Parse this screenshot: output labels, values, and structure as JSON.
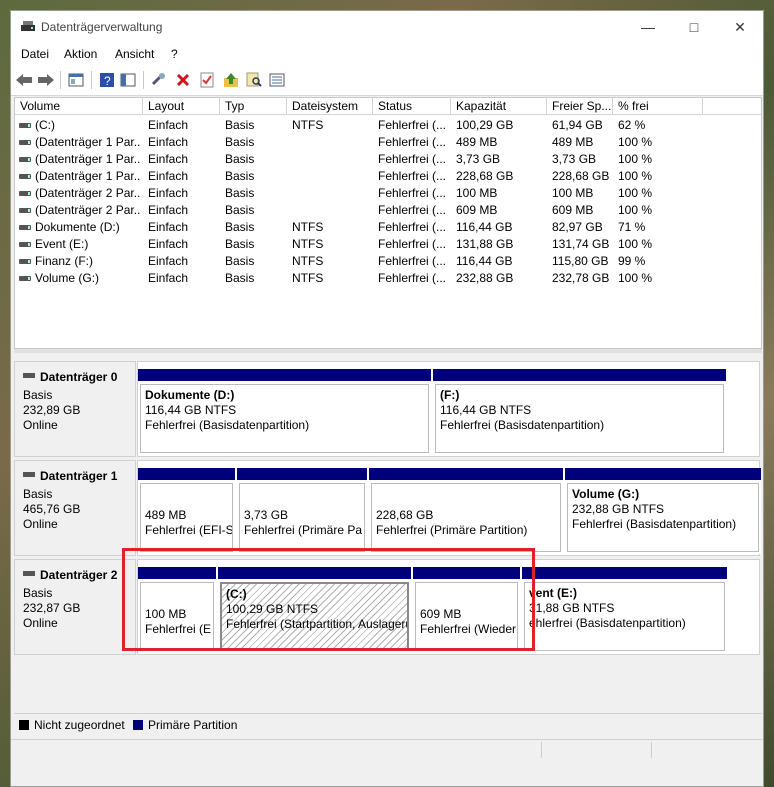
{
  "window": {
    "title": "Datenträgerverwaltung"
  },
  "menu": [
    "Datei",
    "Aktion",
    "Ansicht",
    "?"
  ],
  "columns": [
    "Volume",
    "Layout",
    "Typ",
    "Dateisystem",
    "Status",
    "Kapazität",
    "Freier Sp...",
    "% frei"
  ],
  "volumes": [
    [
      "(C:)",
      "Einfach",
      "Basis",
      "NTFS",
      "Fehlerfrei (...",
      "100,29 GB",
      "61,94 GB",
      "62 %"
    ],
    [
      "(Datenträger 1 Par...",
      "Einfach",
      "Basis",
      "",
      "Fehlerfrei (...",
      "489 MB",
      "489 MB",
      "100 %"
    ],
    [
      "(Datenträger 1 Par...",
      "Einfach",
      "Basis",
      "",
      "Fehlerfrei (...",
      "3,73 GB",
      "3,73 GB",
      "100 %"
    ],
    [
      "(Datenträger 1 Par...",
      "Einfach",
      "Basis",
      "",
      "Fehlerfrei (...",
      "228,68 GB",
      "228,68 GB",
      "100 %"
    ],
    [
      "(Datenträger 2 Par...",
      "Einfach",
      "Basis",
      "",
      "Fehlerfrei (...",
      "100 MB",
      "100 MB",
      "100 %"
    ],
    [
      "(Datenträger 2 Par...",
      "Einfach",
      "Basis",
      "",
      "Fehlerfrei (...",
      "609 MB",
      "609 MB",
      "100 %"
    ],
    [
      "Dokumente (D:)",
      "Einfach",
      "Basis",
      "NTFS",
      "Fehlerfrei (...",
      "116,44 GB",
      "82,97 GB",
      "71 %"
    ],
    [
      "Event (E:)",
      "Einfach",
      "Basis",
      "NTFS",
      "Fehlerfrei (...",
      "131,88 GB",
      "131,74 GB",
      "100 %"
    ],
    [
      "Finanz (F:)",
      "Einfach",
      "Basis",
      "NTFS",
      "Fehlerfrei (...",
      "116,44 GB",
      "115,80 GB",
      "99 %"
    ],
    [
      "Volume (G:)",
      "Einfach",
      "Basis",
      "NTFS",
      "Fehlerfrei (...",
      "232,88 GB",
      "232,78 GB",
      "100 %"
    ]
  ],
  "disks": [
    {
      "name": "Datenträger 0",
      "type": "Basis",
      "size": "232,89 GB",
      "state": "Online",
      "partitions": [
        {
          "title": "Dokumente  (D:)",
          "size": "116,44 GB NTFS",
          "status": "Fehlerfrei (Basisdatenpartition)"
        },
        {
          "title": "(F:)",
          "size": "116,44 GB NTFS",
          "status": "Fehlerfrei (Basisdatenpartition)"
        }
      ]
    },
    {
      "name": "Datenträger 1",
      "type": "Basis",
      "size": "465,76 GB",
      "state": "Online",
      "partitions": [
        {
          "title": "",
          "size": "489 MB",
          "status": "Fehlerfrei (EFI-S"
        },
        {
          "title": "",
          "size": "3,73 GB",
          "status": "Fehlerfrei (Primäre Pa"
        },
        {
          "title": "",
          "size": "228,68 GB",
          "status": "Fehlerfrei (Primäre Partition)"
        },
        {
          "title": "Volume  (G:)",
          "size": "232,88 GB NTFS",
          "status": "Fehlerfrei (Basisdatenpartition)"
        }
      ]
    },
    {
      "name": "Datenträger 2",
      "type": "Basis",
      "size": "232,87 GB",
      "state": "Online",
      "partitions": [
        {
          "title": "",
          "size": "100 MB",
          "status": "Fehlerfrei (E"
        },
        {
          "title": "(C:)",
          "size": "100,29 GB NTFS",
          "status": "Fehlerfrei (Startpartition, Auslageru"
        },
        {
          "title": "",
          "size": "609 MB",
          "status": "Fehlerfrei (Wieder"
        },
        {
          "title": "vent  (E:)",
          "size": "31,88 GB NTFS",
          "status": "ehlerfrei (Basisdatenpartition)"
        }
      ]
    }
  ],
  "legend": {
    "unallocated": "Nicht zugeordnet",
    "primary": "Primäre Partition",
    "colors": {
      "unallocated": "#000000",
      "primary": "#00007a"
    }
  },
  "icons": [
    "back-icon",
    "forward-icon",
    "properties-icon",
    "help-icon",
    "help-pane-icon",
    "connect-icon",
    "delete-icon",
    "check-icon",
    "up-icon",
    "search-icon",
    "view-icon"
  ]
}
